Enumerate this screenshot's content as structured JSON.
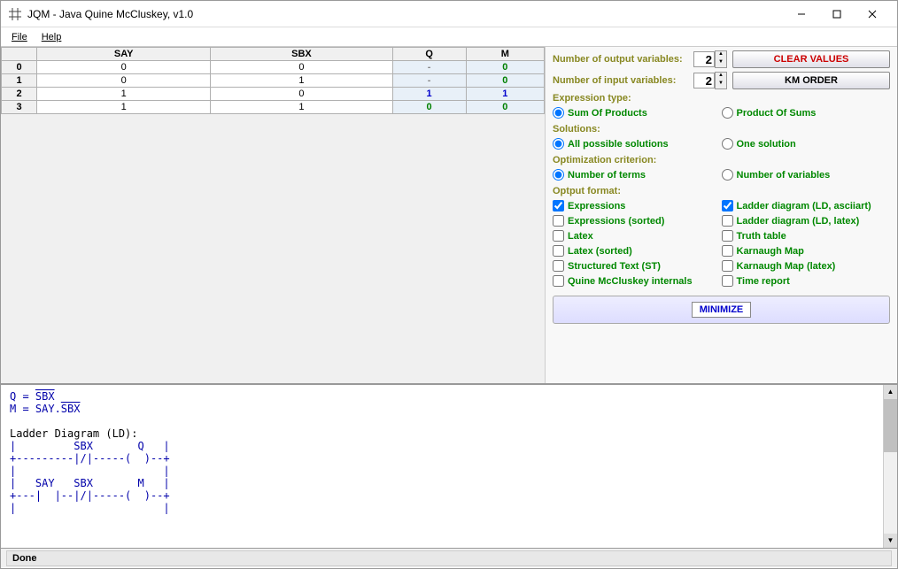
{
  "window": {
    "title": "JQM - Java Quine McCluskey, v1.0"
  },
  "menu": {
    "file": "File",
    "help": "Help"
  },
  "table": {
    "headers": [
      "",
      "SAY",
      "SBX",
      "Q",
      "M"
    ],
    "rows": [
      {
        "idx": "0",
        "inputs": [
          "0",
          "0"
        ],
        "outputs": [
          "-",
          "0"
        ]
      },
      {
        "idx": "1",
        "inputs": [
          "0",
          "1"
        ],
        "outputs": [
          "-",
          "0"
        ]
      },
      {
        "idx": "2",
        "inputs": [
          "1",
          "0"
        ],
        "outputs": [
          "1",
          "1"
        ]
      },
      {
        "idx": "3",
        "inputs": [
          "1",
          "1"
        ],
        "outputs": [
          "0",
          "0"
        ]
      }
    ]
  },
  "options": {
    "num_output_label": "Number of output variables:",
    "num_output_value": "2",
    "num_input_label": "Number  of  input  variables:",
    "num_input_value": "2",
    "clear_values": "CLEAR VALUES",
    "km_order": "KM ORDER",
    "expr_type_label": "Expression type:",
    "sop": "Sum Of Products",
    "pos": "Product Of Sums",
    "solutions_label": "Solutions:",
    "all_solutions": "All possible solutions",
    "one_solution": "One solution",
    "opt_crit_label": "Optimization criterion:",
    "num_terms": "Number of terms",
    "num_vars": "Number of variables",
    "output_fmt_label": "Optput format:",
    "expressions": "Expressions",
    "ladder_ascii": "Ladder diagram (LD, asciiart)",
    "expr_sorted": "Expressions (sorted)",
    "ladder_latex": "Ladder diagram (LD, latex)",
    "latex": "Latex",
    "truth_table": "Truth table",
    "latex_sorted": "Latex (sorted)",
    "kmap": "Karnaugh Map",
    "st": "Structured Text (ST)",
    "kmap_latex": "Karnaugh Map (latex)",
    "qm_internals": "Quine McCluskey internals",
    "time_report": "Time report",
    "minimize": "MINIMIZE"
  },
  "output": {
    "q_prefix": "Q = ",
    "q_val": "SBX",
    "m_prefix": "M = SAY.",
    "m_val": "SBX",
    "ld_title": "Ladder Diagram (LD):",
    "ld": "|         SBX       Q   |\n+---------|/|-----(  )--+\n|                       |\n|   SAY   SBX       M   |\n+---|  |--|/|-----(  )--+\n|                       |"
  },
  "status": {
    "text": "Done"
  }
}
